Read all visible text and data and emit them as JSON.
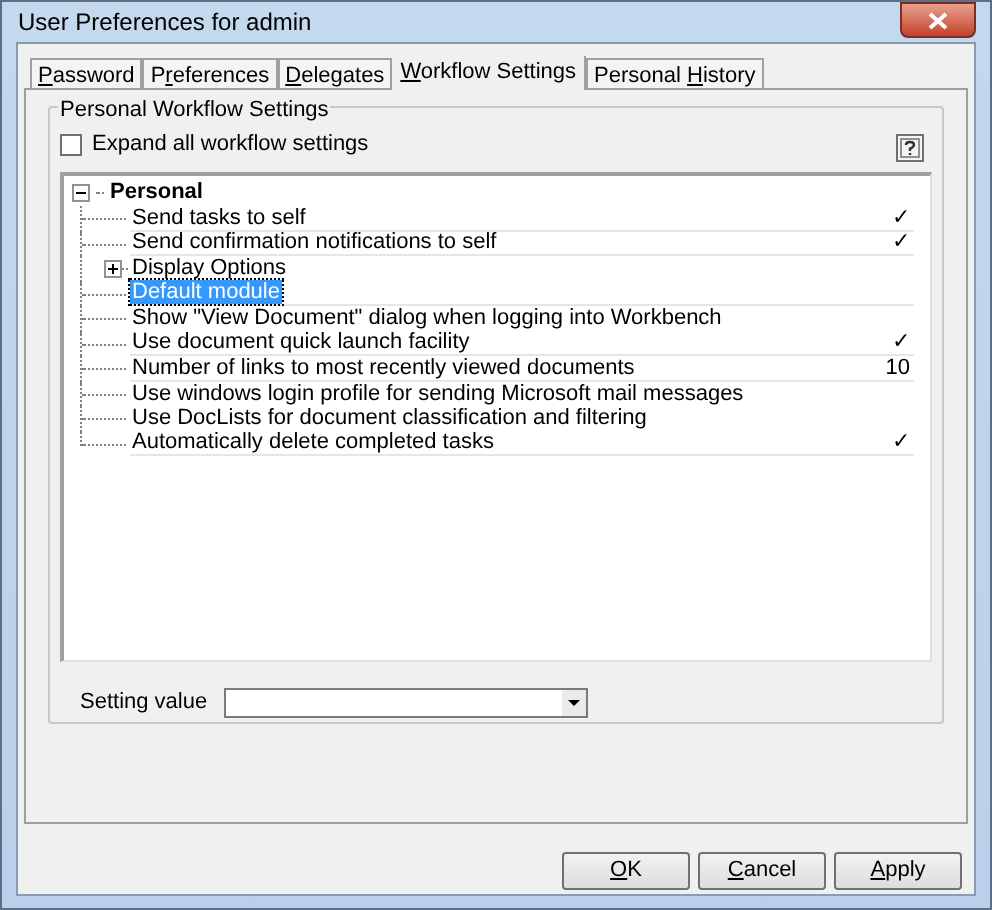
{
  "window": {
    "title": "User Preferences for admin"
  },
  "tabs": [
    {
      "key": "P",
      "post": "assword",
      "selected": false
    },
    {
      "pre": "P",
      "key": "r",
      "post": "eferences",
      "selected": false
    },
    {
      "key": "D",
      "post": "elegates",
      "selected": false
    },
    {
      "key": "W",
      "post": "orkflow Settings",
      "selected": true
    },
    {
      "pre": "Personal ",
      "key": "H",
      "post": "istory",
      "selected": false
    }
  ],
  "group": {
    "title": "Personal Workflow Settings",
    "expand_all": {
      "label": "Expand all workflow settings",
      "checked": false
    }
  },
  "tree": {
    "label": "Personal",
    "expanded": true,
    "children": [
      {
        "label": "Send tasks to self",
        "kind": "field",
        "value": "✓",
        "selected": false
      },
      {
        "label": "Send confirmation notifications to self",
        "kind": "field",
        "value": "✓",
        "selected": false
      },
      {
        "label": "Display Options",
        "kind": "group",
        "expanded": false,
        "selected": false
      },
      {
        "label": "Default module",
        "kind": "field",
        "selected": true
      },
      {
        "label": "Show \"View Document\" dialog when logging into Workbench",
        "kind": "plain",
        "selected": false
      },
      {
        "label": "Use document quick launch facility",
        "kind": "field",
        "value": "✓",
        "selected": false
      },
      {
        "label": "Number of links to most recently viewed documents",
        "kind": "field",
        "value": "10",
        "selected": false
      },
      {
        "label": "Use windows login profile for sending Microsoft mail messages",
        "kind": "plain",
        "selected": false
      },
      {
        "label": "Use DocLists for document classification and filtering",
        "kind": "plain",
        "selected": false
      },
      {
        "label": "Automatically delete completed tasks",
        "kind": "field",
        "value": "✓",
        "selected": false
      }
    ]
  },
  "setting_value": {
    "label": "Setting value"
  },
  "buttons": [
    {
      "key": "O",
      "post": "K"
    },
    {
      "key": "C",
      "post": "ancel"
    },
    {
      "key": "A",
      "post": "pply"
    }
  ]
}
